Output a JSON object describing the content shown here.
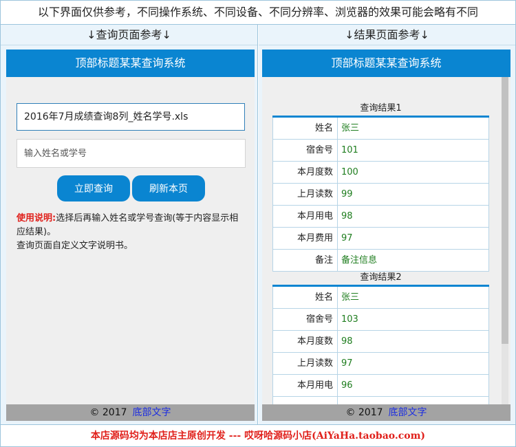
{
  "top_note": "以下界面仅供参考，不同操作系统、不同设备、不同分辨率、浏览器的效果可能会略有不同",
  "left_col": {
    "header": "↓查询页面参考↓",
    "frame_title": "顶部标题某某查询系统",
    "file_select_value": "2016年7月成绩查询8列_姓名学号.xls",
    "input_placeholder": "输入姓名或学号",
    "query_button": "立即查询",
    "refresh_button": "刷新本页",
    "instr_strong": "使用说明:",
    "instr_text": "选择后再输入姓名或学号查询(等于内容显示相应结果)。",
    "instr_custom": "查询页面自定义文字说明书。",
    "footer_copy": "© 2017",
    "footer_link": "底部文字"
  },
  "right_col": {
    "header": "↓结果页面参考↓",
    "frame_title": "顶部标题某某查询系统",
    "result1": {
      "title": "查询结果1",
      "rows": [
        {
          "label": "姓名",
          "value": "张三"
        },
        {
          "label": "宿舍号",
          "value": "101"
        },
        {
          "label": "本月度数",
          "value": "100"
        },
        {
          "label": "上月读数",
          "value": "99"
        },
        {
          "label": "本月用电",
          "value": "98"
        },
        {
          "label": "本月费用",
          "value": "97"
        },
        {
          "label": "备注",
          "value": "备注信息"
        }
      ]
    },
    "result2": {
      "title": "查询结果2",
      "rows": [
        {
          "label": "姓名",
          "value": "张三"
        },
        {
          "label": "宿舍号",
          "value": "103"
        },
        {
          "label": "本月度数",
          "value": "98"
        },
        {
          "label": "上月读数",
          "value": "97"
        },
        {
          "label": "本月用电",
          "value": "96"
        }
      ]
    },
    "footer_copy": "© 2017",
    "footer_link": "底部文字"
  },
  "bottom_note": "本店源码均为本店店主原创开发 --- 哎呀哈源码小店(AiYaHa.taobao.com)",
  "colors": {
    "accent_blue": "#0a85d1",
    "highlight_red": "#e0201b",
    "value_green": "#1e7d1e",
    "link_blue": "#1d2ee0"
  }
}
